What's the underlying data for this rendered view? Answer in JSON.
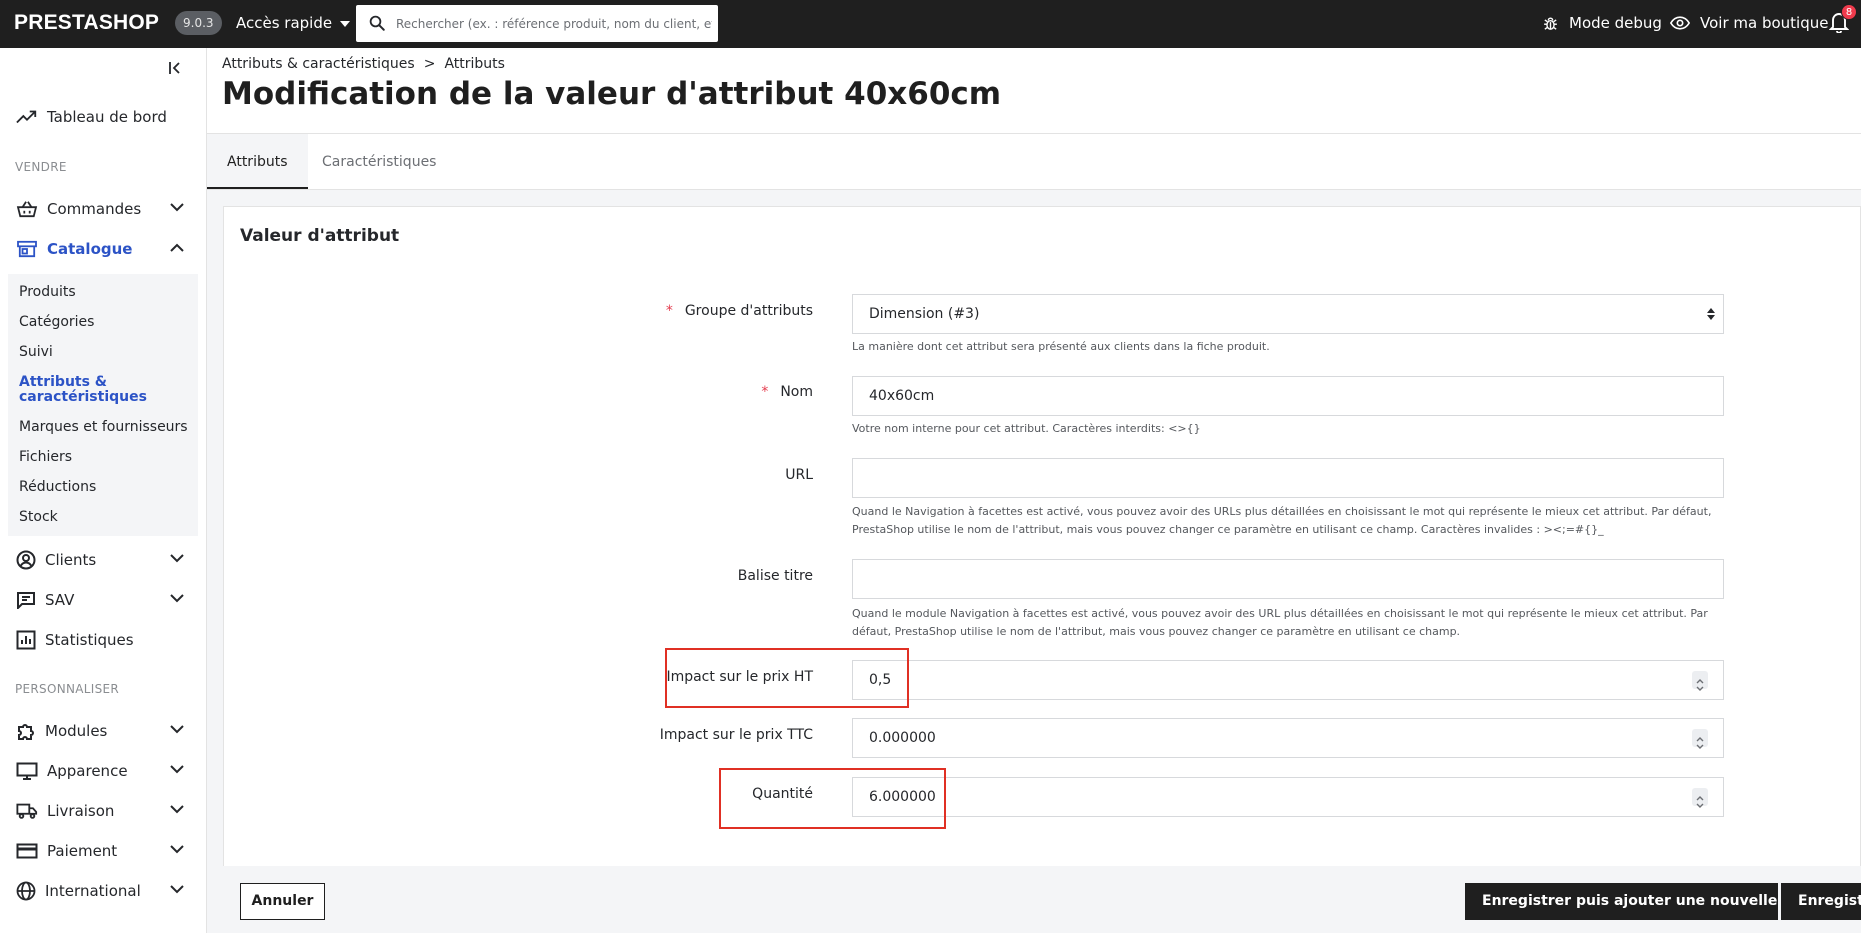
{
  "header": {
    "logo": "PRESTASHOP",
    "version": "9.0.3",
    "quick_access": "Accès rapide",
    "search_placeholder": "Rechercher (ex. : référence produit, nom du client, etc.)",
    "debug_label": "Mode debug",
    "shop_label": "Voir ma boutique",
    "notifications_count": "8"
  },
  "sidebar": {
    "dashboard": "Tableau de bord",
    "section_sell": "VENDRE",
    "orders": "Commandes",
    "catalog": "Catalogue",
    "catalog_sub": [
      "Produits",
      "Catégories",
      "Suivi",
      "Attributs & caractéristiques",
      "Marques et fournisseurs",
      "Fichiers",
      "Réductions",
      "Stock"
    ],
    "customers": "Clients",
    "sav": "SAV",
    "stats": "Statistiques",
    "section_customize": "PERSONNALISER",
    "modules": "Modules",
    "appearance": "Apparence",
    "shipping": "Livraison",
    "payment": "Paiement",
    "international": "International"
  },
  "breadcrumb": {
    "parent": "Attributs & caractéristiques",
    "separator": ">",
    "current": "Attributs"
  },
  "page_title": "Modification de la valeur d'attribut 40x60cm",
  "tabs": [
    "Attributs",
    "Caractéristiques"
  ],
  "form": {
    "title": "Valeur d'attribut",
    "required_marker": "*",
    "group_label": "Groupe d'attributs",
    "group_value": "Dimension (#3)",
    "group_help": "La manière dont cet attribut sera présenté aux clients dans la fiche produit.",
    "name_label": "Nom",
    "name_value": "40x60cm",
    "name_help": "Votre nom interne pour cet attribut. Caractères interdits: <>{}",
    "url_label": "URL",
    "url_value": "",
    "url_help": "Quand le Navigation à facettes est activé, vous pouvez avoir des URLs plus détaillées en choisissant le mot qui représente le mieux cet attribut. Par défaut, PrestaShop utilise le nom de l'attribut, mais vous pouvez changer ce paramètre en utilisant ce champ. Caractères invalides : ><;=#{}_",
    "meta_label": "Balise titre",
    "meta_value": "",
    "meta_help": "Quand le module Navigation à facettes est activé, vous pouvez avoir des URL plus détaillées en choisissant le mot qui représente le mieux cet attribut. Par défaut, PrestaShop utilise le nom de l'attribut, mais vous pouvez changer ce paramètre en utilisant ce champ.",
    "price_ht_label": "Impact sur le prix HT",
    "price_ht_value": "0,5",
    "price_ttc_label": "Impact sur le prix TTC",
    "price_ttc_value": "0.000000",
    "quantity_label": "Quantité",
    "quantity_value": "6.000000"
  },
  "footer": {
    "cancel": "Annuler",
    "save_add": "Enregistrer puis ajouter une nouvelle valeur",
    "save": "Enregistrer"
  },
  "colors": {
    "accent": "#2c53c6",
    "header_bg": "#1f1f1f",
    "highlight": "#e03024"
  }
}
